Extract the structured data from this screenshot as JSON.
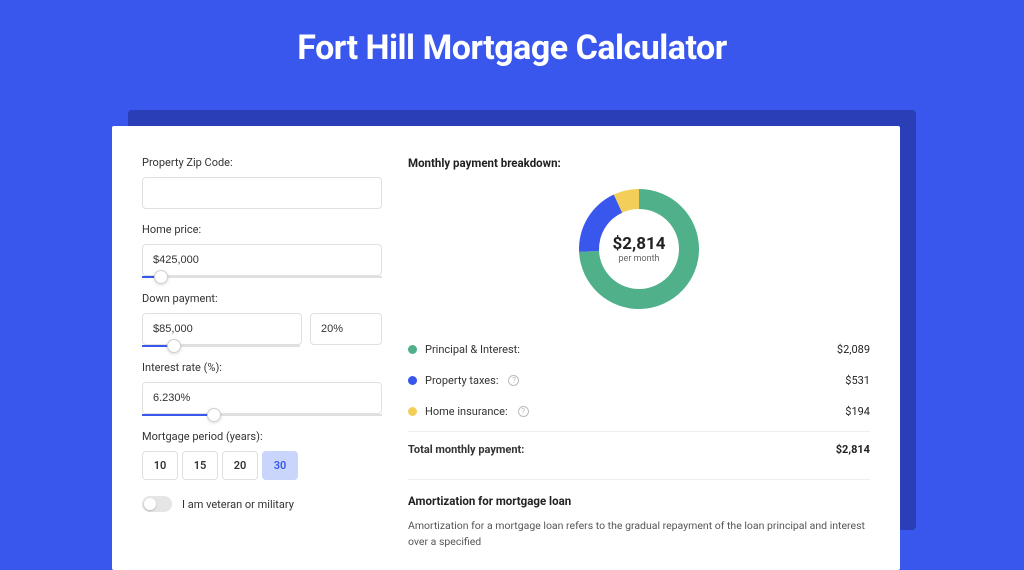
{
  "page": {
    "title": "Fort Hill Mortgage Calculator"
  },
  "form": {
    "zip": {
      "label": "Property Zip Code:",
      "value": ""
    },
    "home_price": {
      "label": "Home price:",
      "value": "$425,000",
      "slider_pct": 8
    },
    "down_payment": {
      "label": "Down payment:",
      "amount": "$85,000",
      "percent": "20%",
      "slider_pct": 20
    },
    "interest_rate": {
      "label": "Interest rate (%):",
      "value": "6.230%",
      "slider_pct": 30
    },
    "period": {
      "label": "Mortgage period (years):",
      "options": [
        "10",
        "15",
        "20",
        "30"
      ],
      "selected": "30"
    },
    "veteran": {
      "label": "I am veteran or military",
      "on": false
    }
  },
  "breakdown": {
    "title": "Monthly payment breakdown:",
    "center_amount": "$2,814",
    "center_sub": "per month",
    "items": [
      {
        "label": "Principal & Interest:",
        "value": "$2,089",
        "color": "#4fb08a",
        "info": false
      },
      {
        "label": "Property taxes:",
        "value": "$531",
        "color": "#3957ed",
        "info": true
      },
      {
        "label": "Home insurance:",
        "value": "$194",
        "color": "#f3cf5a",
        "info": true
      }
    ],
    "total": {
      "label": "Total monthly payment:",
      "value": "$2,814"
    }
  },
  "amortization": {
    "title": "Amortization for mortgage loan",
    "text": "Amortization for a mortgage loan refers to the gradual repayment of the loan principal and interest over a specified"
  },
  "chart_data": {
    "type": "pie",
    "title": "Monthly payment breakdown",
    "series": [
      {
        "name": "Principal & Interest",
        "value": 2089,
        "color": "#4fb08a"
      },
      {
        "name": "Property taxes",
        "value": 531,
        "color": "#3957ed"
      },
      {
        "name": "Home insurance",
        "value": 194,
        "color": "#f3cf5a"
      }
    ],
    "total": 2814,
    "center_label": "$2,814 per month"
  }
}
